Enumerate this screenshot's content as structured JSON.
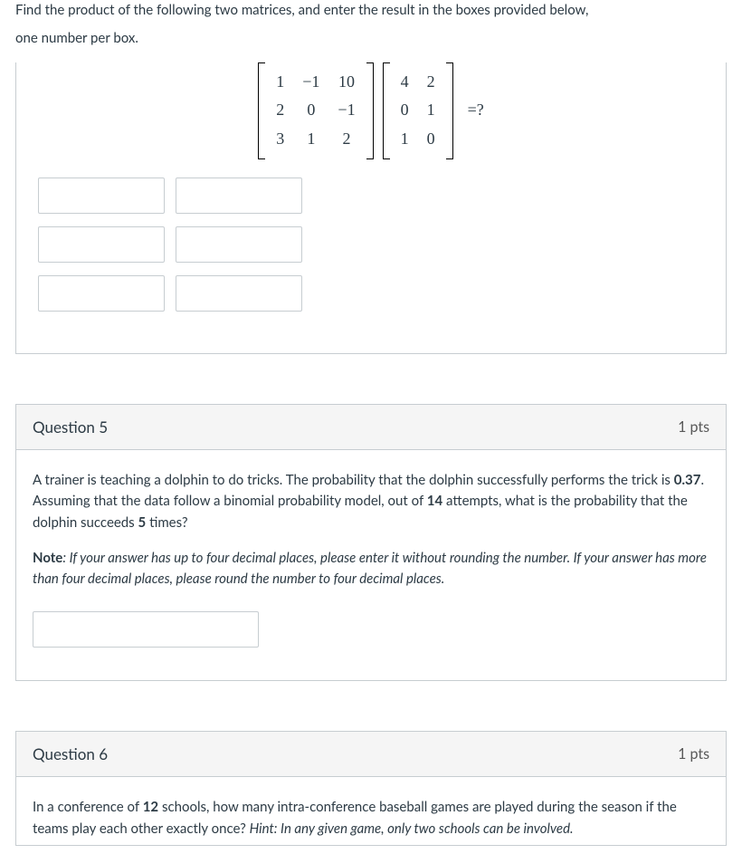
{
  "q4": {
    "intro1": "Find the product of the following two matrices, and enter the result in the boxes provided below,",
    "intro2": "one number per box.",
    "matrixA": [
      [
        "1",
        "−1",
        "10"
      ],
      [
        "2",
        "0",
        "−1"
      ],
      [
        "3",
        "1",
        "2"
      ]
    ],
    "matrixB": [
      [
        "4",
        "2"
      ],
      [
        "0",
        "1"
      ],
      [
        "1",
        "0"
      ]
    ],
    "eq": "=?"
  },
  "q5": {
    "title": "Question 5",
    "pts": "1 pts",
    "text_parts": {
      "p1": "A trainer is teaching a dolphin to do tricks. The probability that the dolphin successfully performs the trick is ",
      "v1": "0.37",
      "p2": ". Assuming that the data follow a binomial probability model,  out of ",
      "v2": "14",
      "p3": "  attempts, what is the probability that the dolphin succeeds ",
      "v3": "5",
      "p4": "  times?"
    },
    "note_label": "Note",
    "note_text": ": If your answer has up to four decimal places, please enter it without rounding the number. If your answer has more than four decimal places, please round the number to four decimal places."
  },
  "q6": {
    "title": "Question 6",
    "pts": "1 pts",
    "text_parts": {
      "p1": "In a conference of ",
      "v1": "12",
      "p2": "  schools, how many intra-conference baseball games are played during the season if the teams play each other exactly once? ",
      "hint": "Hint: In any given game, only two schools can be involved."
    }
  }
}
